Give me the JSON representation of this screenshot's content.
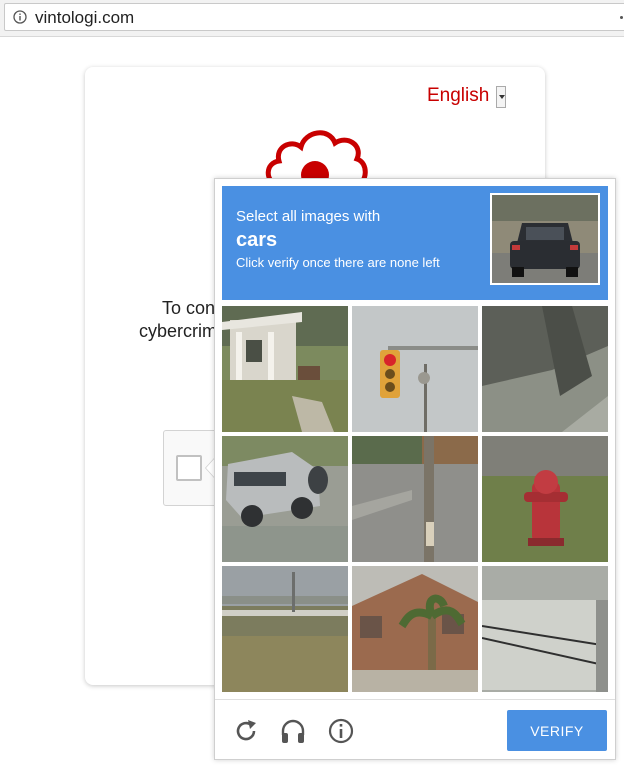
{
  "browser": {
    "url": "vintologi.com",
    "info_icon": "info-circle-icon"
  },
  "page": {
    "language": "English",
    "logo_icon": "red-cloud-logo",
    "text_line1": "To con",
    "text_line2": "cybercrim",
    "brand_color": "#c80000"
  },
  "captcha": {
    "instruction": "Select all images with",
    "target": "cars",
    "hint": "Click verify once there are none left",
    "accent_color": "#4a90e2",
    "tiles": [
      {
        "depicts": "house-porch"
      },
      {
        "depicts": "traffic-light"
      },
      {
        "depicts": "shadowed-road"
      },
      {
        "depicts": "silver-suv"
      },
      {
        "depicts": "pole-road"
      },
      {
        "depicts": "fire-hydrant"
      },
      {
        "depicts": "overpass"
      },
      {
        "depicts": "house-palm"
      },
      {
        "depicts": "building-wires"
      }
    ],
    "footer": {
      "reload_icon": "reload-icon",
      "audio_icon": "headphones-icon",
      "info_icon": "info-icon",
      "verify_label": "VERIFY"
    }
  }
}
